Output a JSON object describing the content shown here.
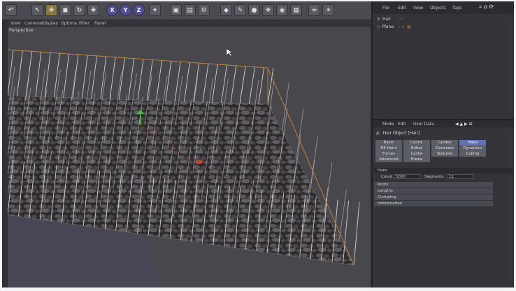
{
  "toolbar": {
    "axis_buttons": [
      "X",
      "Y",
      "Z"
    ]
  },
  "viewport_menu": [
    "View",
    "Cameras",
    "Display",
    "Options",
    "Filter",
    "Panel"
  ],
  "viewport": {
    "label": "Perspective"
  },
  "object_manager": {
    "menu": [
      "File",
      "Edit",
      "View",
      "Objects",
      "Tags"
    ],
    "objects": [
      {
        "name": "Hair"
      },
      {
        "name": "Plane"
      }
    ]
  },
  "attribute_manager": {
    "menu": [
      "Mode",
      "Edit",
      "User Data"
    ],
    "object_title": "Hair Object [Hair]",
    "tabs": [
      [
        "Basic",
        "Coord.",
        "Guides",
        "Hairs"
      ],
      [
        "Fill Hairs",
        "Editor",
        "Generate",
        "Dynamics"
      ],
      [
        "Forces",
        "Cache",
        "Textures",
        "Culling"
      ],
      [
        "Advanced",
        "Frame",
        "",
        ""
      ]
    ],
    "active_tab": "Hairs",
    "section_header": "Hairs",
    "count_label": "Count",
    "count_value": "5000",
    "segments_label": "Segments",
    "segments_value": "12",
    "collapsed_sections": [
      "Roots",
      "Lengths",
      "Clumping",
      "Interpolation"
    ]
  },
  "colors": {
    "accent": "#5f72b8",
    "bounding_box": "#c98a3a",
    "hair_guides": "#e8e8f0"
  }
}
